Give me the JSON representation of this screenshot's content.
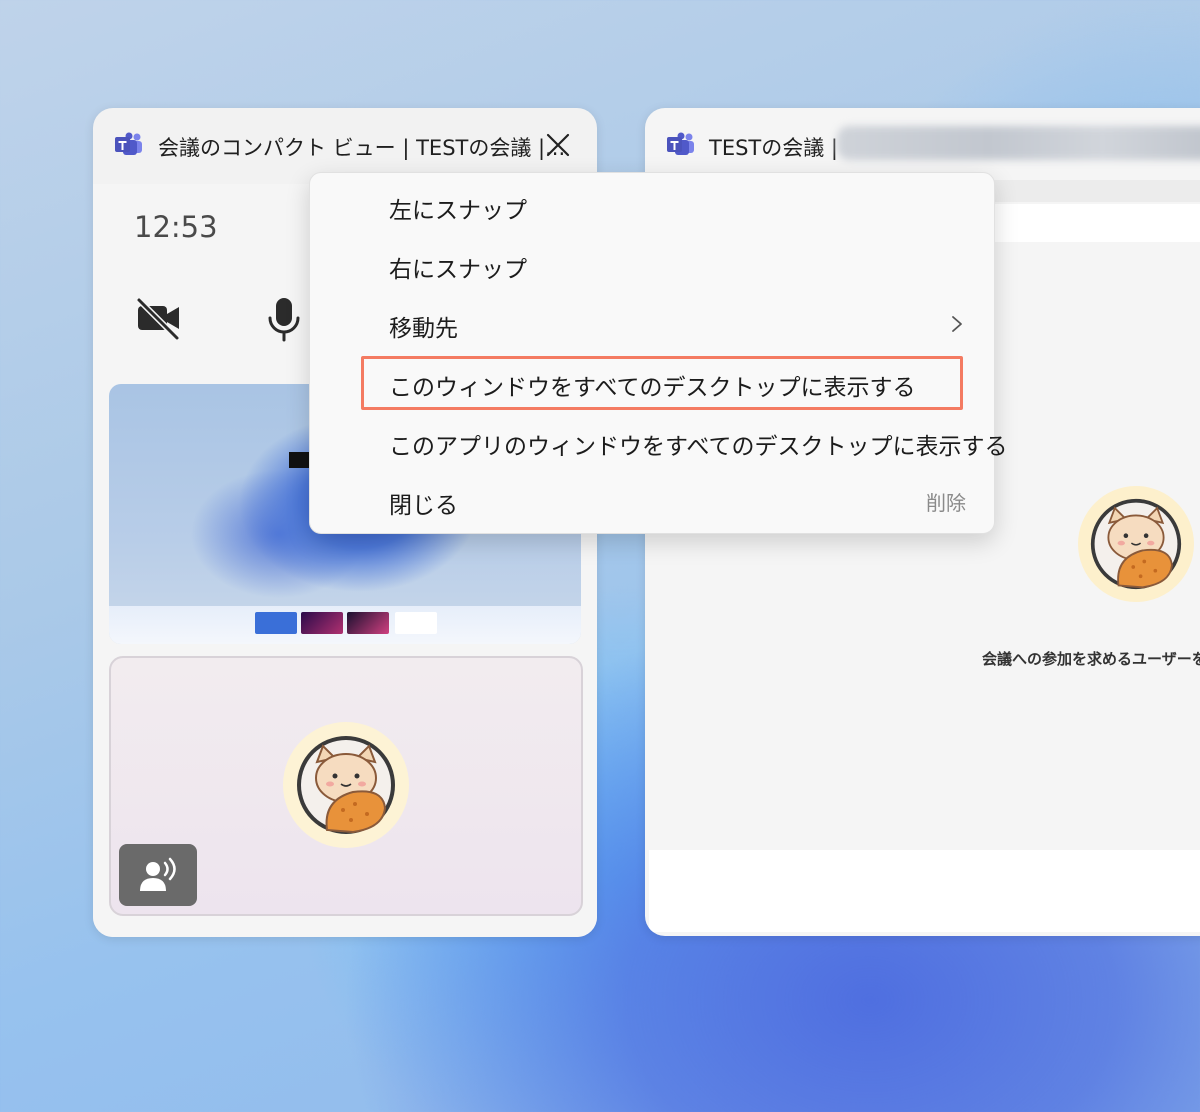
{
  "left_window": {
    "title": "会議のコンパクト ビュー | TESTの会議 |...",
    "clock": "12:53"
  },
  "right_window": {
    "title": "TESTの会議 |",
    "invite_text": "会議への参加を求めるユーザーを招"
  },
  "context_menu": {
    "items": [
      {
        "label": "左にスナップ"
      },
      {
        "label": "右にスナップ"
      },
      {
        "label": "移動先"
      },
      {
        "label": "このウィンドウをすべてのデスクトップに表示する"
      },
      {
        "label": "このアプリのウィンドウをすべてのデスクトップに表示する"
      },
      {
        "label": "閉じる",
        "shortcut": "削除"
      }
    ]
  },
  "colors": {
    "teams_brand": "#5b5fc7",
    "highlight": "#f47b62"
  },
  "icons": [
    "teams-icon",
    "close-icon",
    "camera-off-icon",
    "mic-icon",
    "chevron-right-icon",
    "speaker-icon",
    "avatar-cat"
  ]
}
